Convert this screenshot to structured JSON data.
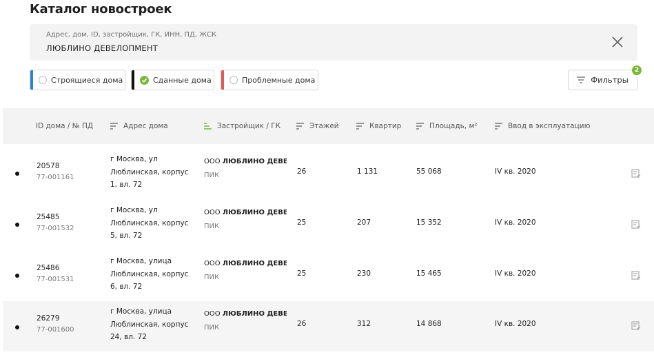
{
  "page_title": "Каталог новостроек",
  "search": {
    "placeholder": "Адрес, дом, ID, застройщик, ГК, ИНН, ПД, ЖСК",
    "value": "ЛЮБЛИНО ДЕВЕЛОПМЕНТ"
  },
  "status_filters": [
    {
      "label": "Строящиеся дома",
      "color": "#2f80d7",
      "selected": false
    },
    {
      "label": "Сданные дома",
      "color": "#111111",
      "selected": true
    },
    {
      "label": "Проблемные дома",
      "color": "#e05a5a",
      "selected": false
    }
  ],
  "filters_button": {
    "label": "Фильтры",
    "count": "2"
  },
  "columns": [
    {
      "label": "ID дома / № ПД",
      "icon": "",
      "active": false
    },
    {
      "label": "Адрес дома",
      "icon": "sort-icon",
      "active": false
    },
    {
      "label": "Застройщик / ГК",
      "icon": "sort-icon",
      "active": true
    },
    {
      "label": "Этажей",
      "icon": "sort-icon",
      "active": false
    },
    {
      "label": "Квартир",
      "icon": "sort-icon",
      "active": false
    },
    {
      "label": "Площадь, м²",
      "icon": "sort-icon",
      "active": false
    },
    {
      "label": "Ввод в эксплуатацию",
      "icon": "sort-icon",
      "active": false
    }
  ],
  "rows": [
    {
      "id": "20578",
      "pd": "77-001161",
      "address": "г Москва, ул Люблинская, корпус 1, вл. 72",
      "dev_prefix": "ООО ",
      "dev_name": "ЛЮБЛИНО ДЕВЕ...",
      "gk": "ПИК",
      "floors": "26",
      "flats": "1 131",
      "area": "55 068",
      "commission": "IV кв. 2020"
    },
    {
      "id": "25485",
      "pd": "77-001532",
      "address": "г Москва, ул Люблинская, корпус 5, вл. 72",
      "dev_prefix": "ООО ",
      "dev_name": "ЛЮБЛИНО ДЕВЕ...",
      "gk": "ПИК",
      "floors": "25",
      "flats": "207",
      "area": "15 352",
      "commission": "IV кв. 2020"
    },
    {
      "id": "25486",
      "pd": "77-001531",
      "address": "г Москва, улица Люблинская, корпус 6, вл. 72",
      "dev_prefix": "ООО ",
      "dev_name": "ЛЮБЛИНО ДЕВЕ...",
      "gk": "ПИК",
      "floors": "25",
      "flats": "230",
      "area": "15 465",
      "commission": "IV кв. 2020"
    },
    {
      "id": "26279",
      "pd": "77-001600",
      "address": "г Москва, улица Люблинская, корпус 24, вл. 72",
      "dev_prefix": "ООО ",
      "dev_name": "ЛЮБЛИНО ДЕВЕ...",
      "gk": "ПИК",
      "floors": "26",
      "flats": "312",
      "area": "14 868",
      "commission": "IV кв. 2020"
    }
  ],
  "colors": {
    "accent": "#7ab83a",
    "text": "#222222",
    "muted": "#777777"
  }
}
